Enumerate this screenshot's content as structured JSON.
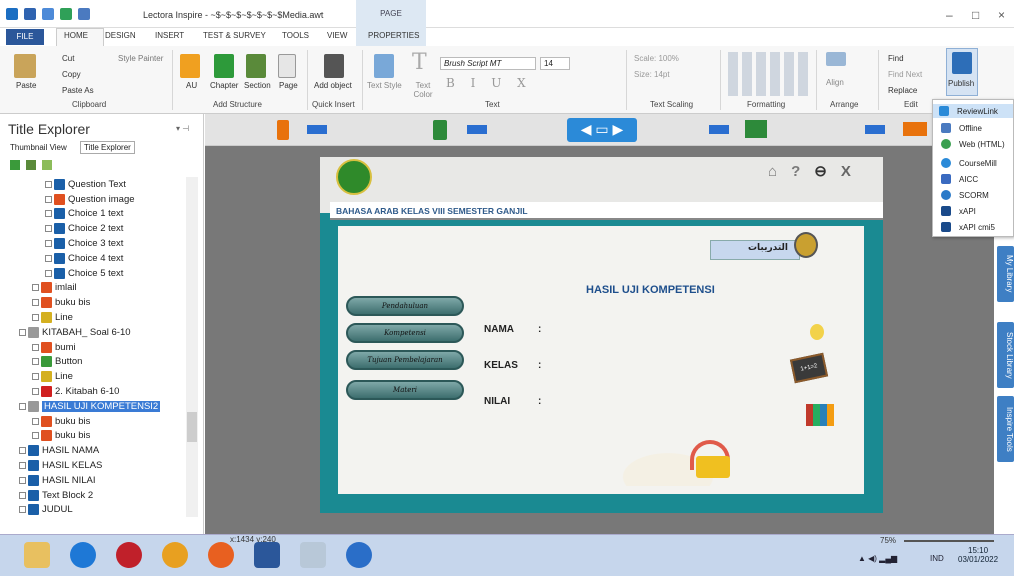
{
  "window": {
    "title": "Lectora Inspire - ~$~$~$~$~$~$~$Media.awt",
    "context_group": "PAGE"
  },
  "tabs": [
    "FILE",
    "HOME",
    "DESIGN",
    "INSERT",
    "TEST & SURVEY",
    "TOOLS",
    "VIEW",
    "PROPERTIES"
  ],
  "ribbon": {
    "clipboard": {
      "cut": "Cut",
      "copy": "Copy",
      "paste": "Paste",
      "paste_as": "Paste As",
      "style_painter": "Style Painter",
      "group": "Clipboard"
    },
    "structure": {
      "au": "AU",
      "chapter": "Chapter",
      "section": "Section",
      "page": "Page",
      "group": "Add Structure"
    },
    "insert": {
      "add_object": "Add object",
      "group": "Quick Insert"
    },
    "text": {
      "text_style": "Text Style",
      "text_color": "Text Color",
      "font": "Brush Script MT",
      "size": "14",
      "group": "Text"
    },
    "scaling": {
      "scale": "Scale: 100%",
      "size": "Size: 14pt",
      "group": "Text Scaling"
    },
    "formatting": {
      "group": "Formatting"
    },
    "arrange": {
      "align": "Align",
      "group": "Arrange"
    },
    "edit": {
      "find": "Find",
      "find_next": "Find Next",
      "replace": "Replace",
      "group": "Edit"
    },
    "publish": {
      "label": "Publish"
    }
  },
  "explorer": {
    "title": "Title Explorer",
    "tab_thumb": "Thumbnail View",
    "tab_title": "Title Explorer",
    "items": [
      {
        "label": "Question Text",
        "indent": 3,
        "color": "#1a5fa8",
        "sel": false
      },
      {
        "label": "Question image",
        "indent": 3,
        "color": "#e05020",
        "sel": false
      },
      {
        "label": "Choice 1 text",
        "indent": 3,
        "color": "#1a5fa8",
        "sel": false
      },
      {
        "label": "Choice 2 text",
        "indent": 3,
        "color": "#1a5fa8",
        "sel": false
      },
      {
        "label": "Choice 3 text",
        "indent": 3,
        "color": "#1a5fa8",
        "sel": false
      },
      {
        "label": "Choice 4 text",
        "indent": 3,
        "color": "#1a5fa8",
        "sel": false
      },
      {
        "label": "Choice 5 text",
        "indent": 3,
        "color": "#1a5fa8",
        "sel": false
      },
      {
        "label": "imlail",
        "indent": 2,
        "color": "#e05020",
        "sel": false
      },
      {
        "label": "buku bis",
        "indent": 2,
        "color": "#e05020",
        "sel": false
      },
      {
        "label": "Line",
        "indent": 2,
        "color": "#d4b020",
        "sel": false
      },
      {
        "label": "KITABAH_ Soal 6-10",
        "indent": 1,
        "color": "#999",
        "sel": false
      },
      {
        "label": "bumi",
        "indent": 2,
        "color": "#e05020",
        "sel": false
      },
      {
        "label": "Button",
        "indent": 2,
        "color": "#3a9a3a",
        "sel": false
      },
      {
        "label": "Line",
        "indent": 2,
        "color": "#d4b020",
        "sel": false
      },
      {
        "label": "2. Kitabah 6-10",
        "indent": 2,
        "color": "#d02020",
        "sel": false
      },
      {
        "label": "HASIL UJI KOMPETENSI2",
        "indent": 1,
        "color": "#999",
        "sel": true
      },
      {
        "label": "buku bis",
        "indent": 2,
        "color": "#e05020",
        "sel": false
      },
      {
        "label": "buku bis",
        "indent": 2,
        "color": "#e05020",
        "sel": false
      },
      {
        "label": "HASIL NAMA",
        "indent": 1,
        "color": "#1a5fa8",
        "sel": false
      },
      {
        "label": "HASIL KELAS",
        "indent": 1,
        "color": "#1a5fa8",
        "sel": false
      },
      {
        "label": "HASIL NILAI",
        "indent": 1,
        "color": "#1a5fa8",
        "sel": false
      },
      {
        "label": "Text Block 2",
        "indent": 1,
        "color": "#1a5fa8",
        "sel": false
      },
      {
        "label": "JUDUL",
        "indent": 1,
        "color": "#1a5fa8",
        "sel": false
      }
    ]
  },
  "slide": {
    "banner": "BAHASA ARAB KELAS VIII SEMESTER GANJIL",
    "heading": "HASIL UJI KOMPETENSI",
    "arabic_tag": "التدريبات",
    "nav_icons": [
      "⌂",
      "?",
      "⊖",
      "X"
    ],
    "menu_buttons": [
      "Pendahuluan",
      "Kompetensi",
      "Tujuan Pembelajaran",
      "Materi"
    ],
    "fields": [
      {
        "label": "NAMA",
        "sep": ":"
      },
      {
        "label": "KELAS",
        "sep": ":"
      },
      {
        "label": "NILAI",
        "sep": ":"
      }
    ],
    "chalk": "1+1=2"
  },
  "publish_menu": [
    "ReviewLink",
    "Offline",
    "Web (HTML)",
    "CourseMill",
    "AICC",
    "SCORM",
    "xAPI",
    "xAPI cmi5"
  ],
  "side_tabs": [
    "My Library",
    "Stock Library",
    "Inspire Tools"
  ],
  "status": {
    "coords": "x:1434 y:240",
    "zoom": "75%"
  },
  "clock": {
    "time": "15:10",
    "date": "03/01/2022",
    "lang": "IND"
  }
}
